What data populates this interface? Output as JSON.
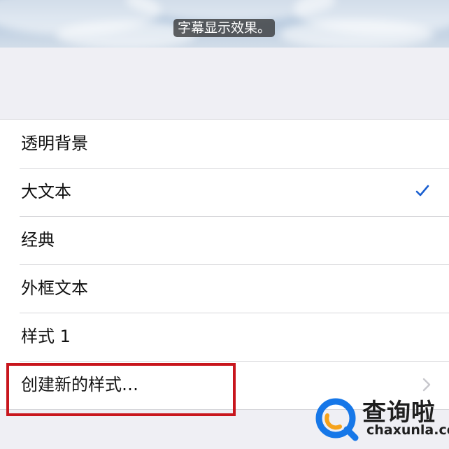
{
  "preview": {
    "caption_text": "字幕显示效果。"
  },
  "styles_list": {
    "items": [
      {
        "label": "透明背景",
        "selected": false
      },
      {
        "label": "大文本",
        "selected": true
      },
      {
        "label": "经典",
        "selected": false
      },
      {
        "label": "外框文本",
        "selected": false
      },
      {
        "label": "样式 1",
        "selected": false
      },
      {
        "label": "创建新的样式…",
        "disclosure": true
      }
    ]
  },
  "icons": {
    "selected": "checkmark-icon",
    "disclosure": "chevron-right-icon"
  },
  "colors": {
    "accent": "#1a5fd0",
    "annotation": "#c8161d",
    "watermark_blue": "#1677e8",
    "watermark_orange": "#f5a21b"
  },
  "watermark": {
    "name": "查询啦",
    "domain": "chaxunla.com"
  }
}
